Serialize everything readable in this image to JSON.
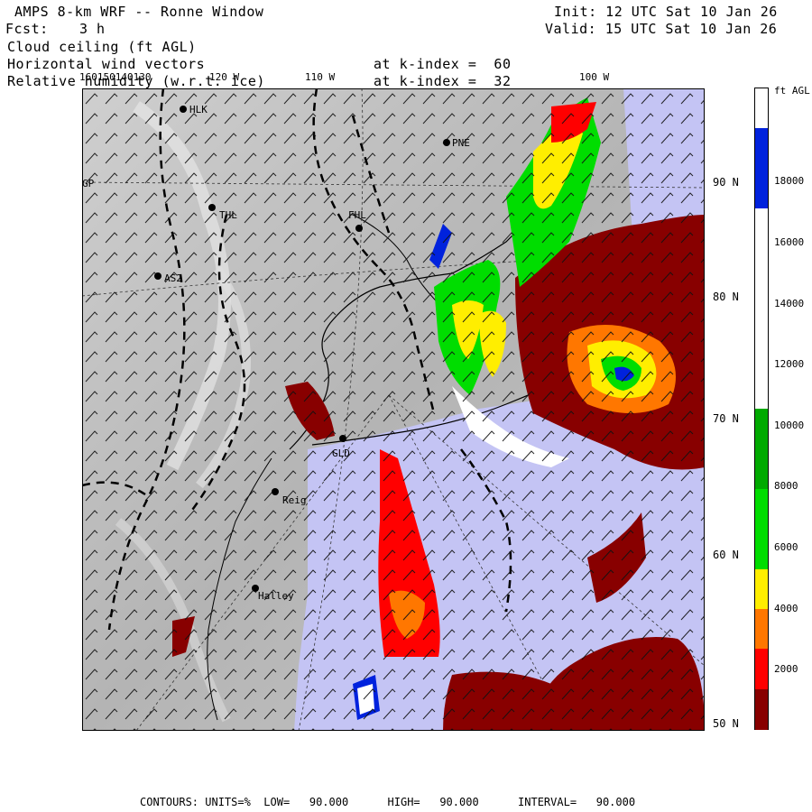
{
  "header": {
    "title": "AMPS 8-km WRF -- Ronne Window",
    "forecast_label": "Fcst:",
    "forecast_value": "3 h",
    "init": "Init: 12 UTC Sat 10 Jan 26",
    "valid": "Valid: 15 UTC Sat 10 Jan 26",
    "field1": "Cloud ceiling (ft AGL)",
    "field2": "Horizontal wind vectors",
    "field2_level": "at k-index =  60",
    "field3": "Relative humidity (w.r.t. ice)",
    "field3_level": "at k-index =  32"
  },
  "longitude_labels": [
    "160150140130",
    "120 W",
    "110 W",
    "100 W"
  ],
  "latitude_labels": [
    "90 N",
    "80 N",
    "70 N",
    "60 N",
    "50 N"
  ],
  "stations": [
    "HLK",
    "PNE",
    "THL",
    "FHL",
    "AS2",
    "GLD",
    "Reig",
    "Halley",
    "GP"
  ],
  "colorbar": {
    "unit_label": "ft AGL",
    "tick_labels": [
      "18000",
      "16000",
      "14000",
      "12000",
      "10000",
      "8000",
      "6000",
      "4000",
      "2000"
    ],
    "segments": [
      {
        "color": "#ffffff"
      },
      {
        "color": "#0022dd"
      },
      {
        "color": "#0022dd"
      },
      {
        "color": "#ffffff"
      },
      {
        "color": "#ffffff"
      },
      {
        "color": "#ffffff"
      },
      {
        "color": "#ffffff"
      },
      {
        "color": "#ffffff"
      },
      {
        "color": "#00aa00"
      },
      {
        "color": "#00aa00"
      },
      {
        "color": "#00dd00"
      },
      {
        "color": "#00dd00"
      },
      {
        "color": "#ffee00"
      },
      {
        "color": "#ff7700"
      },
      {
        "color": "#ff0000"
      },
      {
        "color": "#880000"
      }
    ]
  },
  "footer": "CONTOURS: UNITS=%  LOW=   90.000      HIGH=   90.000      INTERVAL=   90.000",
  "colors": {
    "land": "#bdbdbd",
    "ocean_rh": "#c4c4f4",
    "low_cloud": "#880000",
    "red": "#ff0000",
    "orange": "#ff7700",
    "yellow": "#ffee00",
    "green": "#00dd00",
    "dkgreen": "#00aa00",
    "blue": "#0022dd"
  }
}
